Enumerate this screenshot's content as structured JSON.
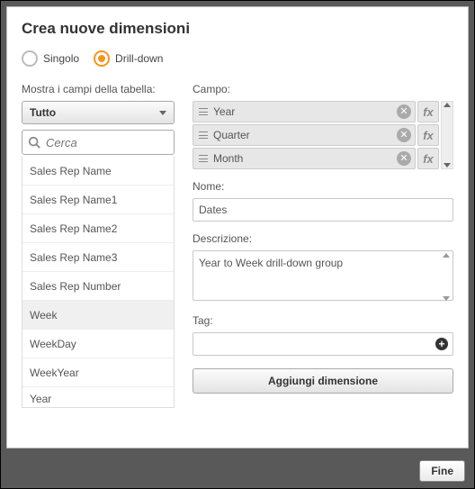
{
  "title": "Crea nuove dimensioni",
  "radios": {
    "single": "Singolo",
    "drilldown": "Drill-down"
  },
  "left": {
    "tableLabel": "Mostra i campi della tabella:",
    "tableSelected": "Tutto",
    "searchPlaceholder": "Cerca",
    "fields": [
      "Sales Rep Name",
      "Sales Rep Name1",
      "Sales Rep Name2",
      "Sales Rep Name3",
      "Sales Rep Number",
      "Week",
      "WeekDay",
      "WeekYear",
      "Year"
    ]
  },
  "right": {
    "campoLabel": "Campo:",
    "campoItems": [
      "Year",
      "Quarter",
      "Month"
    ],
    "nomeLabel": "Nome:",
    "nomeValue": "Dates",
    "descLabel": "Descrizione:",
    "descValue": "Year to Week drill-down group",
    "tagLabel": "Tag:",
    "addButton": "Aggiungi dimensione"
  },
  "footer": {
    "done": "Fine"
  },
  "fx": "fx"
}
